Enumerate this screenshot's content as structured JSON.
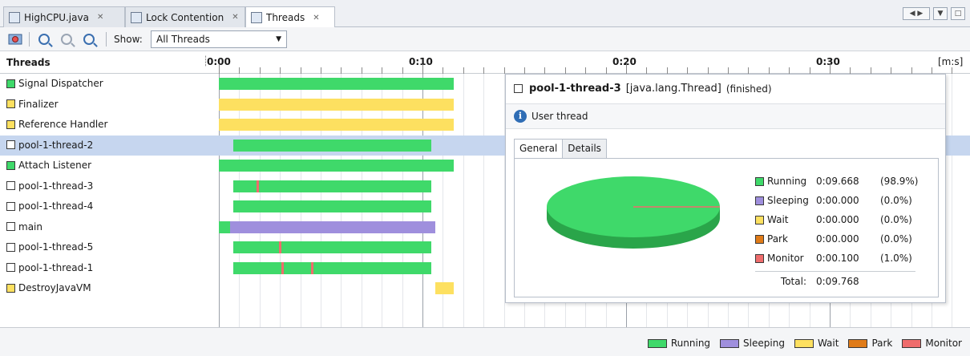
{
  "tabs": [
    {
      "label": "HighCPU.java",
      "icon": "java-file-icon",
      "active": false
    },
    {
      "label": "Lock Contention",
      "icon": "lock-icon",
      "active": false
    },
    {
      "label": "Threads",
      "icon": "threads-icon",
      "active": true
    }
  ],
  "toolbar": {
    "show_label": "Show:",
    "show_value": "All Threads"
  },
  "timeline": {
    "column_title": "Threads",
    "ticks": [
      "0:00",
      "0:10",
      "0:20",
      "0:30"
    ],
    "unit": "[m:s]"
  },
  "colors": {
    "running": "#3fd96a",
    "sleeping": "#9f8fdd",
    "wait": "#fde060",
    "park": "#e07b18",
    "monitor": "#ef6c6c",
    "finished": "#ffffff"
  },
  "threads": [
    {
      "name": "Signal Dispatcher",
      "state": "running",
      "selected": false
    },
    {
      "name": "Finalizer",
      "state": "wait",
      "selected": false
    },
    {
      "name": "Reference Handler",
      "state": "wait",
      "selected": false
    },
    {
      "name": "pool-1-thread-2",
      "state": "finished",
      "selected": true
    },
    {
      "name": "Attach Listener",
      "state": "running",
      "selected": false
    },
    {
      "name": "pool-1-thread-3",
      "state": "finished",
      "selected": false
    },
    {
      "name": "pool-1-thread-4",
      "state": "finished",
      "selected": false
    },
    {
      "name": "main",
      "state": "finished",
      "selected": false
    },
    {
      "name": "pool-1-thread-5",
      "state": "finished",
      "selected": false
    },
    {
      "name": "pool-1-thread-1",
      "state": "finished",
      "selected": false
    },
    {
      "name": "DestroyJavaVM",
      "state": "wait",
      "selected": false
    }
  ],
  "popup": {
    "thread_name": "pool-1-thread-3",
    "thread_type": "[java.lang.Thread]",
    "status": "(finished)",
    "subtitle": "User thread",
    "tabs": [
      "General",
      "Details"
    ],
    "states": [
      {
        "name": "Running",
        "time": "0:09.668",
        "pct": "(98.9%)",
        "color": "#3fd96a"
      },
      {
        "name": "Sleeping",
        "time": "0:00.000",
        "pct": "(0.0%)",
        "color": "#9f8fdd"
      },
      {
        "name": "Wait",
        "time": "0:00.000",
        "pct": "(0.0%)",
        "color": "#fde060"
      },
      {
        "name": "Park",
        "time": "0:00.000",
        "pct": "(0.0%)",
        "color": "#e07b18"
      },
      {
        "name": "Monitor",
        "time": "0:00.100",
        "pct": "(1.0%)",
        "color": "#ef6c6c"
      }
    ],
    "total_label": "Total:",
    "total_value": "0:09.768",
    "pie_fractions": {
      "running": 0.989,
      "monitor": 0.01
    }
  },
  "legend": [
    {
      "label": "Running",
      "color": "#3fd96a"
    },
    {
      "label": "Sleeping",
      "color": "#9f8fdd"
    },
    {
      "label": "Wait",
      "color": "#fde060"
    },
    {
      "label": "Park",
      "color": "#e07b18"
    },
    {
      "label": "Monitor",
      "color": "#ef6c6c"
    }
  ]
}
